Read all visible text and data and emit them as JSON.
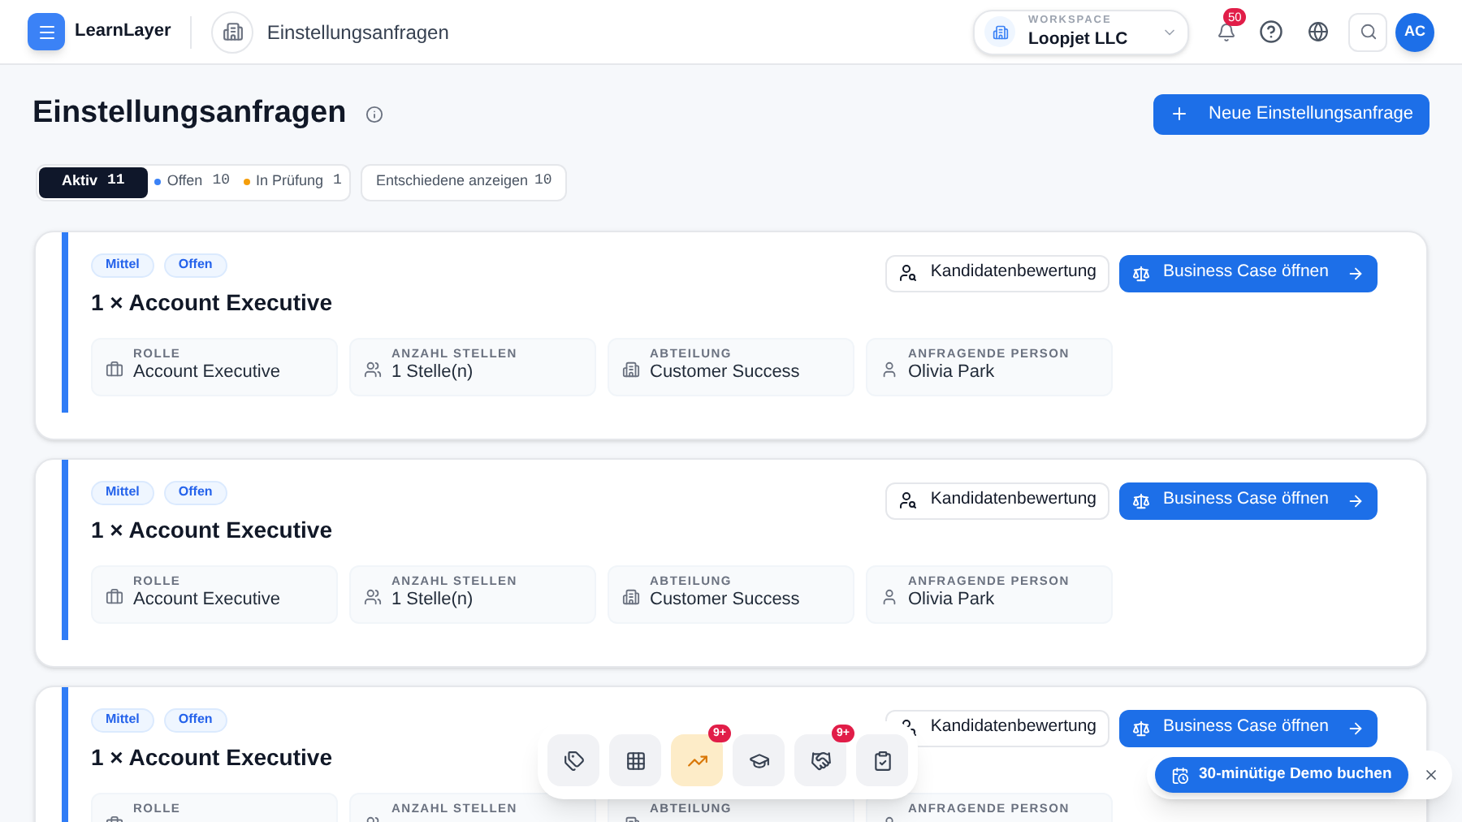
{
  "app": {
    "name": "LearnLayer"
  },
  "breadcrumb": {
    "title": "Einstellungsanfragen"
  },
  "workspace": {
    "label": "WORKSPACE",
    "name": "Loopjet LLC"
  },
  "notifications": {
    "count": "50"
  },
  "avatar": {
    "initials": "AC"
  },
  "page": {
    "title": "Einstellungsanfragen",
    "new_button": "Neue Einstellungsanfrage"
  },
  "filters": [
    {
      "label": "Aktiv",
      "count": "11",
      "selected": true
    },
    {
      "label": "Offen",
      "count": "10",
      "color": "#3b82f6",
      "selected": false
    },
    {
      "label": "In Prüfung",
      "count": "1",
      "color": "#f59e0b",
      "selected": false
    }
  ],
  "toggle": {
    "label": "Entschiedene anzeigen",
    "count": "10"
  },
  "requests": [
    {
      "tags": [
        "Mittel",
        "Offen"
      ],
      "title": "1 × Account Executive",
      "secondary_action": "Kandidatenbewertung",
      "primary_action": "Business Case öffnen",
      "fields": [
        {
          "label": "ROLLE",
          "value": "Account Executive"
        },
        {
          "label": "ANZAHL STELLEN",
          "value": "1 Stelle(n)"
        },
        {
          "label": "ABTEILUNG",
          "value": "Customer Success"
        },
        {
          "label": "ANFRAGENDE PERSON",
          "value": "Olivia Park"
        }
      ]
    },
    {
      "tags": [
        "Mittel",
        "Offen"
      ],
      "title": "1 × Account Executive",
      "secondary_action": "Kandidatenbewertung",
      "primary_action": "Business Case öffnen",
      "fields": [
        {
          "label": "ROLLE",
          "value": "Account Executive"
        },
        {
          "label": "ANZAHL STELLEN",
          "value": "1 Stelle(n)"
        },
        {
          "label": "ABTEILUNG",
          "value": "Customer Success"
        },
        {
          "label": "ANFRAGENDE PERSON",
          "value": "Olivia Park"
        }
      ]
    },
    {
      "tags": [
        "Mittel",
        "Offen"
      ],
      "title": "1 × Account Executive",
      "secondary_action": "Kandidatenbewertung",
      "primary_action": "Business Case öffnen",
      "fields": [
        {
          "label": "ROLLE"
        },
        {
          "label": "ANZAHL STELLEN"
        },
        {
          "label": "ABTEILUNG"
        },
        {
          "label": "ANFRAGENDE PERSON"
        }
      ]
    }
  ],
  "dock": [
    {
      "selected": false
    },
    {
      "selected": false
    },
    {
      "selected": true,
      "badge": "9+"
    },
    {
      "selected": false
    },
    {
      "selected": false,
      "badge": "9+"
    },
    {
      "selected": false
    }
  ],
  "demo": {
    "label": "30-minütige Demo buchen"
  }
}
